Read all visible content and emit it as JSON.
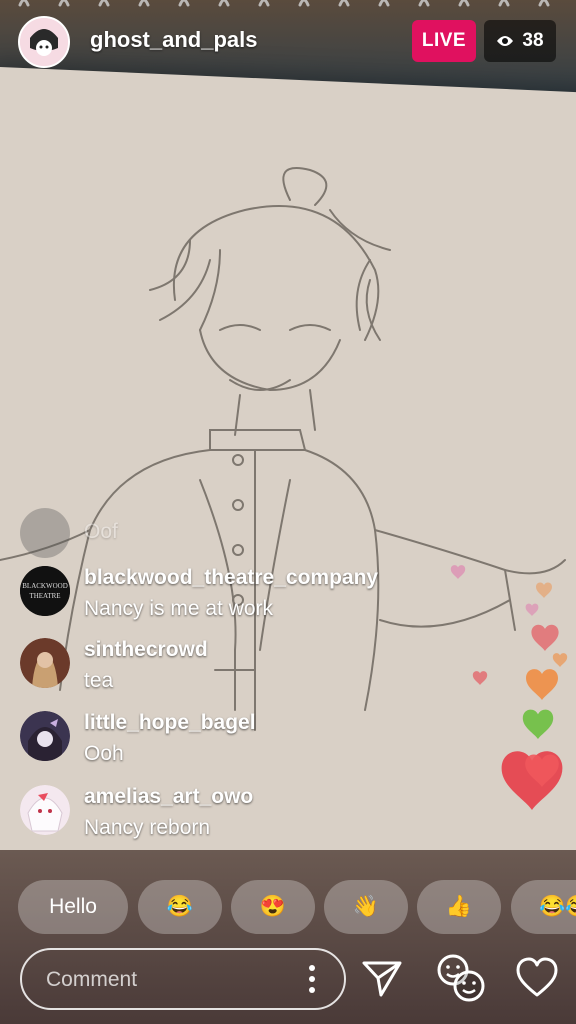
{
  "header": {
    "username": "ghost_and_pals",
    "live_label": "LIVE",
    "viewer_count": "38"
  },
  "comments": [
    {
      "user": "",
      "text": "Oof",
      "faded": true
    },
    {
      "user": "blackwood_theatre_company",
      "text": "Nancy is me at work",
      "avatar_text": "BLACKWOOD THEATRE"
    },
    {
      "user": "sinthecrowd",
      "text": "tea"
    },
    {
      "user": "little_hope_bagel",
      "text": "Ooh"
    },
    {
      "user": "amelias_art_owo",
      "text": "Nancy reborn"
    }
  ],
  "quick_replies": [
    "Hello",
    "😂",
    "😍",
    "👋",
    "👍",
    "😂😂"
  ],
  "composer": {
    "placeholder": "Comment"
  },
  "icons": [
    "eye-icon",
    "more-icon",
    "send-icon",
    "face-filter-icon",
    "heart-icon"
  ],
  "colors": {
    "live": "#e0115f",
    "heart_red": "#e6454f",
    "heart_orange": "#f08a3c",
    "heart_green": "#6bbf3f",
    "heart_pink": "#e06aa8"
  }
}
